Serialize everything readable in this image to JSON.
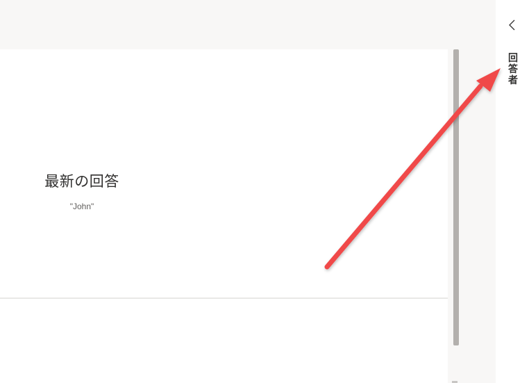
{
  "summary_card": {
    "title": "最新の回答",
    "value": "\"John\""
  },
  "side_panel": {
    "collapse_icon": "chevron-left-icon",
    "label_chars": [
      "回",
      "答",
      "者"
    ]
  },
  "annotation": {
    "arrow_color": "#f04848"
  },
  "colors": {
    "page_bg": "#f8f7f6",
    "card_bg": "#ffffff",
    "scrollbar_thumb": "#b3b0ad",
    "text_primary": "#323130",
    "text_secondary": "#605e5c"
  }
}
